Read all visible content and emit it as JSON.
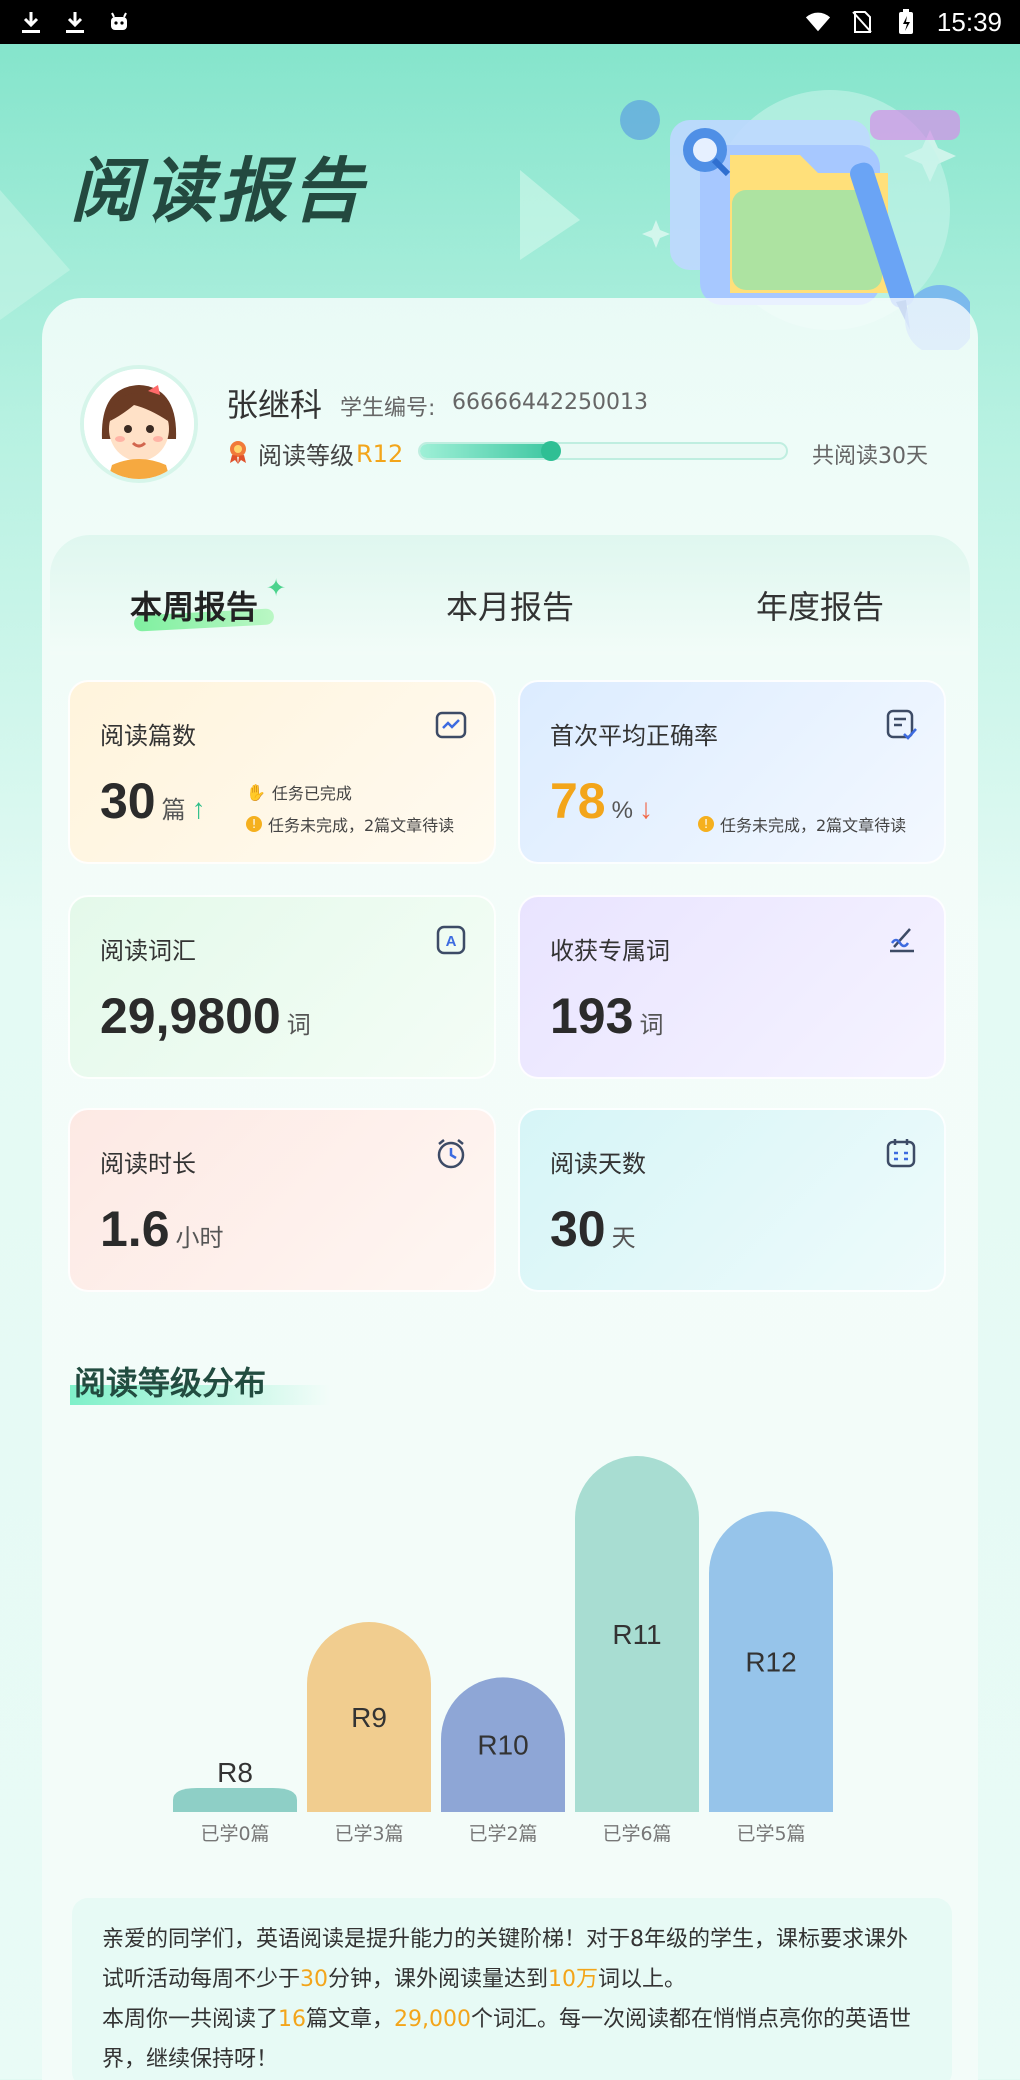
{
  "status_bar": {
    "time": "15:39",
    "left_icons": [
      "download-icon",
      "download-icon",
      "android-icon"
    ],
    "right_icons": [
      "wifi-icon",
      "no-sim-icon",
      "battery-charging-icon"
    ]
  },
  "header": {
    "title": "阅读报告"
  },
  "student": {
    "name": "张继科",
    "id_label": "学生编号:",
    "id": "66666442250013",
    "level_label": "阅读等级",
    "level": "R12",
    "level_progress": 0.36,
    "total_days": "共阅读30天"
  },
  "tabs": [
    {
      "label": "本周报告",
      "active": true
    },
    {
      "label": "本月报告",
      "active": false
    },
    {
      "label": "年度报告",
      "active": false
    }
  ],
  "stats": {
    "articles": {
      "title": "阅读篇数",
      "value": "30",
      "unit": "篇",
      "trend": "↑",
      "task_done": "任务已完成",
      "task_pending": "任务未完成，2篇文章待读"
    },
    "accuracy": {
      "title": "首次平均正确率",
      "value": "78",
      "unit": "%",
      "trend": "↓",
      "task_pending": "任务未完成，2篇文章待读"
    },
    "vocab": {
      "title": "阅读词汇",
      "value": "29,9800",
      "unit": "词"
    },
    "special_words": {
      "title": "收获专属词",
      "value": "193",
      "unit": "词"
    },
    "duration": {
      "title": "阅读时长",
      "value": "1.6",
      "unit": "小时"
    },
    "days": {
      "title": "阅读天数",
      "value": "30",
      "unit": "天"
    }
  },
  "level_distribution": {
    "title": "阅读等级分布"
  },
  "chart_data": {
    "type": "bar",
    "categories": [
      "R8",
      "R9",
      "R10",
      "R11",
      "R12"
    ],
    "values": [
      0,
      3,
      2,
      6,
      5
    ],
    "value_labels": [
      "已学0篇",
      "已学3篇",
      "已学2篇",
      "已学6篇",
      "已学5篇"
    ],
    "colors": [
      "#8ecfc6",
      "#f1cd8f",
      "#8ea6d6",
      "#a8ddd2",
      "#96c4ea"
    ],
    "ylim": [
      0,
      6
    ]
  },
  "note": {
    "p1_a": "亲爱的同学们，英语阅读是提升能力的关键阶梯！对于8年级的学生，课标要求课外试听活动每周不少于",
    "p1_b": "30",
    "p1_c": "分钟，课外阅读量达到",
    "p1_d": "10万",
    "p1_e": "词以上。",
    "p2_a": "本周你一共阅读了",
    "p2_b": "16",
    "p2_c": "篇文章，",
    "p2_d": "29,000",
    "p2_e": "个词汇。每一次阅读都在悄悄点亮你的英语世界，继续保持呀！"
  }
}
